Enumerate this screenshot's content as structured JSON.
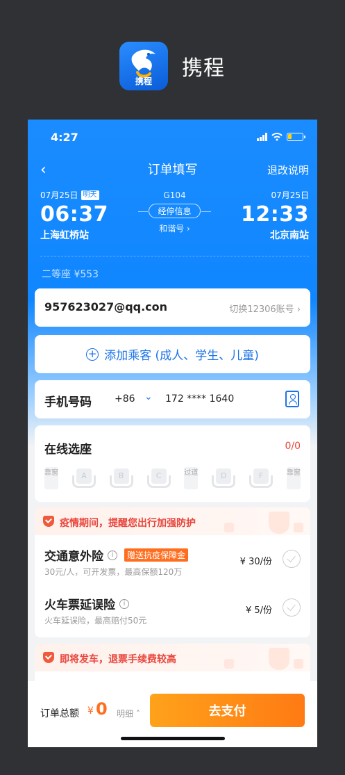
{
  "app": {
    "name": "携程",
    "logo_text": "携程"
  },
  "status_bar": {
    "time": "4:27"
  },
  "nav": {
    "back": "‹",
    "title": "订单填写",
    "right": "退改说明"
  },
  "trip": {
    "depart_date": "07月25日",
    "depart_tag": "明天",
    "depart_time": "06:37",
    "depart_station": "上海虹桥站",
    "train_no": "G104",
    "stops_button": "经停信息",
    "train_type": "和谐号 ›",
    "arrive_date": "07月25日",
    "arrive_time": "12:33",
    "arrive_station": "北京南站",
    "seat_price": "二等座 ¥553"
  },
  "account": {
    "email": "957623027@qq.con",
    "switch": "切换12306账号 ›"
  },
  "add_passenger": {
    "icon": "+",
    "label": "添加乘客 (成人、学生、儿童)"
  },
  "phone": {
    "label": "手机号码",
    "country_code": "+86",
    "chevron": "⌄",
    "number": "172 **** 1640"
  },
  "seat_select": {
    "label": "在线选座",
    "count": "0/0",
    "window_left": "靠窗",
    "aisle": "过道",
    "window_right": "靠窗",
    "seats": [
      "A",
      "B",
      "C",
      "D",
      "F"
    ]
  },
  "insurance": {
    "banner": "疫情期间，提醒您出行加强防护",
    "items": [
      {
        "name": "交通意外险",
        "info": "i",
        "gift": "赠送抗疫保障金",
        "desc": "30元/人，可开发票，最高保额120万",
        "price": "¥ 30/份"
      },
      {
        "name": "火车票延误险",
        "info": "i",
        "desc": "火车延误险，最高赔付50元",
        "price": "¥ 5/份"
      }
    ]
  },
  "warning": {
    "banner": "即将发车，退票手续费较高"
  },
  "bottom": {
    "total_label": "订单总额",
    "yen": "¥",
    "amount": "0",
    "detail": "明细 ˄",
    "pay": "去支付"
  },
  "colors": {
    "primary": "#1b8cff",
    "accent": "#ff7a14",
    "warn": "#e8453c"
  }
}
